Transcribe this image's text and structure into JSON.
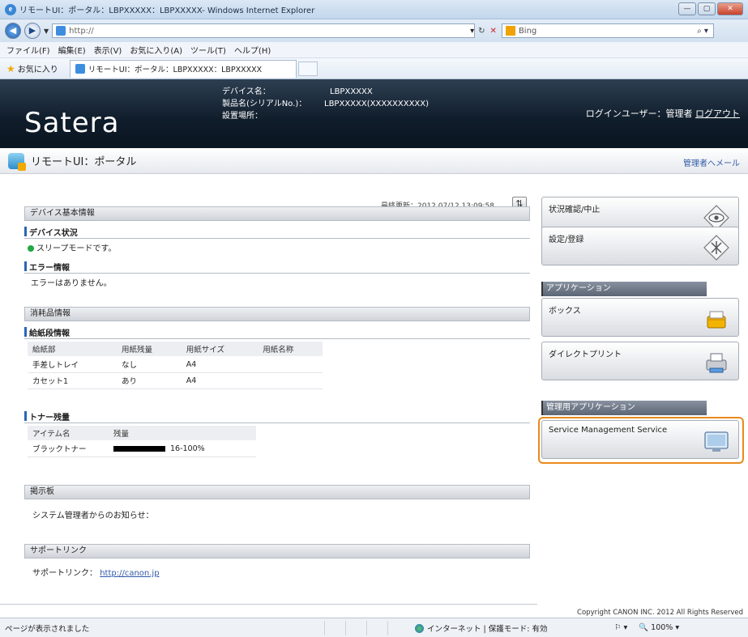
{
  "window": {
    "title": "リモートUI：ポータル：LBPXXXXX：LBPXXXXX- Windows Internet Explorer",
    "buttons": [
      "—",
      "▢",
      "✕"
    ]
  },
  "address": {
    "url": "http://",
    "search_placeholder": "Bing"
  },
  "menu": [
    "ファイル(F)",
    "編集(E)",
    "表示(V)",
    "お気に入り(A)",
    "ツール(T)",
    "ヘルプ(H)"
  ],
  "favorites": {
    "label": "お気に入り",
    "tab_title": "リモートUI：ポータル：LBPXXXXX：LBPXXXXX"
  },
  "header": {
    "logo": "Satera",
    "device_name_label": "デバイス名：",
    "product_label": "製品名(シリアルNo.)：",
    "location_label": "設置場所：",
    "device_name": "LBPXXXXX",
    "product": "LBPXXXXX(XXXXXXXXXX)",
    "login_label": "ログインユーザー：管理者",
    "logout": "ログアウト"
  },
  "subbar": {
    "title": "リモートUI：ポータル",
    "admin_mail": "管理者へメール"
  },
  "main": {
    "last_updated": "最終更新：2012 07/12 13:09:58",
    "device_basic": "デバイス基本情報",
    "device_status_head": "デバイス状況",
    "device_status": "スリープモードです。",
    "error_head": "エラー情報",
    "error_text": "エラーはありません。",
    "consumables": "消耗品情報",
    "paper_head": "給紙段情報",
    "paper_cols": [
      "給紙部",
      "用紙残量",
      "用紙サイズ",
      "用紙名称"
    ],
    "paper_rows": [
      [
        "手差しトレイ",
        "なし",
        "A4",
        ""
      ],
      [
        "カセット1",
        "あり",
        "A4",
        ""
      ]
    ],
    "toner_head": "トナー残量",
    "toner_cols": [
      "アイテム名",
      "残量"
    ],
    "toner_rows": [
      [
        "ブラックトナー",
        "16-100%"
      ]
    ],
    "notice_head": "掲示板",
    "notice_text": "システム管理者からのお知らせ：",
    "support_head": "サポートリンク",
    "support_label": "サポートリンク：",
    "support_url": "http://canon.jp"
  },
  "right": {
    "status_monitor": "状況確認/中止",
    "settings": "設定/登録",
    "apps_head": "アプリケーション",
    "box": "ボックス",
    "direct_print": "ダイレクトプリント",
    "admin_apps_head": "管理用アプリケーション",
    "sms": "Service Management Service"
  },
  "footer": {
    "copyright": "Copyright CANON INC. 2012 All Rights Reserved",
    "status_text": "ページが表示されました",
    "zone": "インターネット | 保護モード: 有効",
    "zoom": "100%"
  }
}
